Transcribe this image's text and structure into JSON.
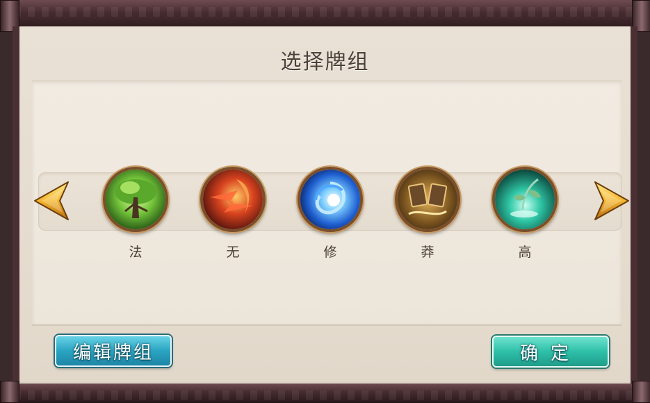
{
  "dialog": {
    "title": "选择牌组"
  },
  "decks": [
    {
      "label": "法",
      "theme": "tree",
      "color": "#7ed04a"
    },
    {
      "label": "无",
      "theme": "flame",
      "color": "#c8321e"
    },
    {
      "label": "修",
      "theme": "vortex",
      "color": "#2a7fe0"
    },
    {
      "label": "莽",
      "theme": "cards",
      "color": "#c88a2c"
    },
    {
      "label": "高",
      "theme": "leaf",
      "color": "#2fc7a6"
    }
  ],
  "nav": {
    "prev_icon": "left-arrow-icon",
    "next_icon": "right-arrow-icon"
  },
  "buttons": {
    "edit_label": "编辑牌组",
    "confirm_label": "确定"
  }
}
